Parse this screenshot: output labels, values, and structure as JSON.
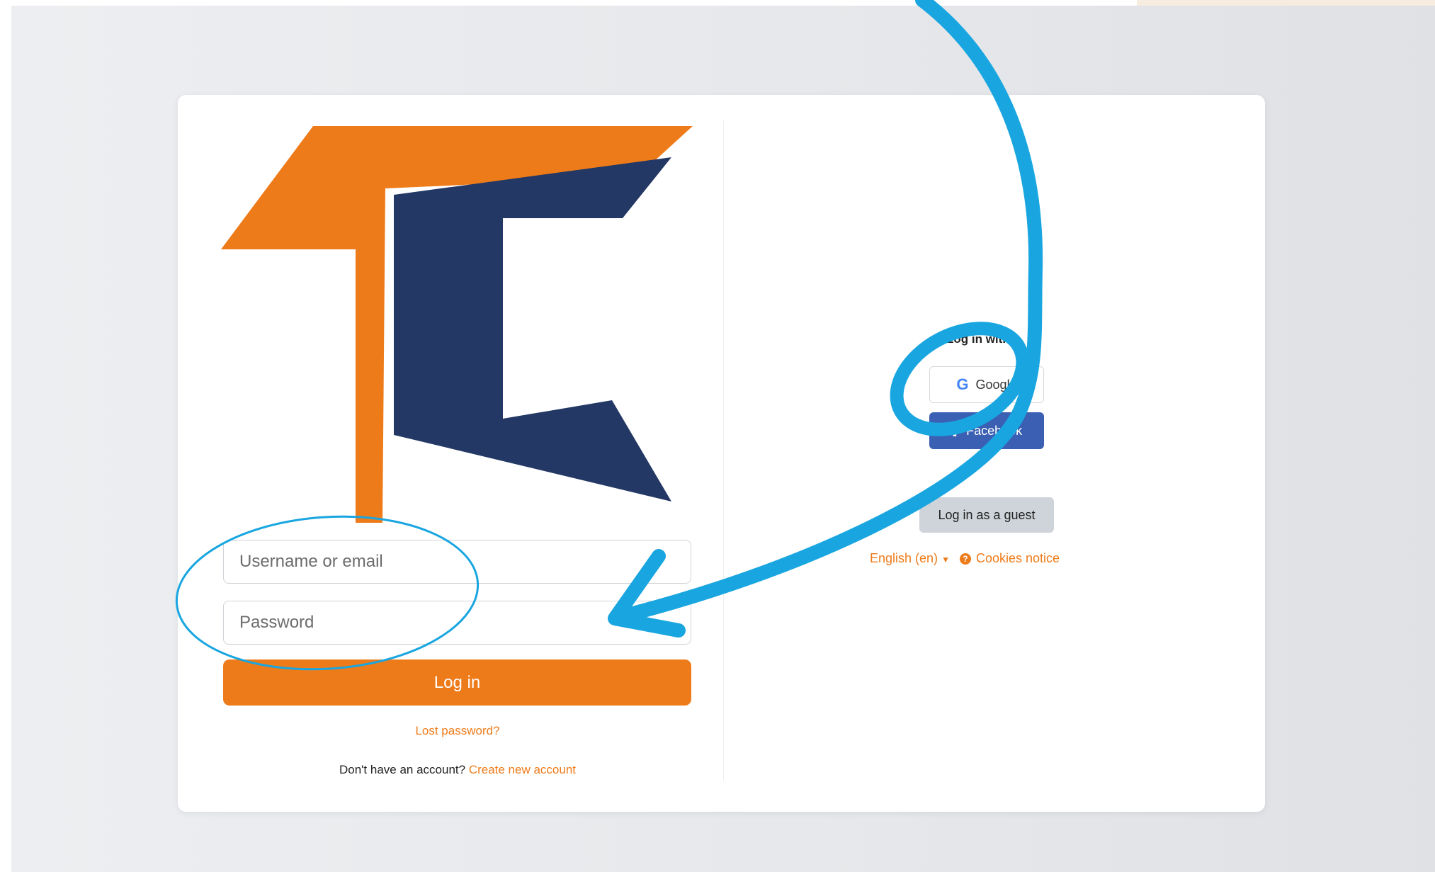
{
  "colors": {
    "accent": "#ee7b1a",
    "logo_orange": "#ee7b1a",
    "logo_navy": "#233864",
    "facebook": "#3b5fb3",
    "annotation_blue": "#19a6e0"
  },
  "login": {
    "username_placeholder": "Username or email",
    "password_placeholder": "Password",
    "submit_label": "Log in",
    "lost_password": "Lost password?",
    "no_account_text": "Don't have an account?",
    "create_account": "Create new account"
  },
  "social": {
    "heading": "Log in with",
    "google_icon": "google-g-icon",
    "google_label": "Google",
    "facebook_icon": "facebook-f-icon",
    "facebook_label": "Facebook"
  },
  "guest": {
    "label": "Log in as a guest"
  },
  "footer": {
    "language": "English (en)",
    "cookies": "Cookies notice"
  }
}
